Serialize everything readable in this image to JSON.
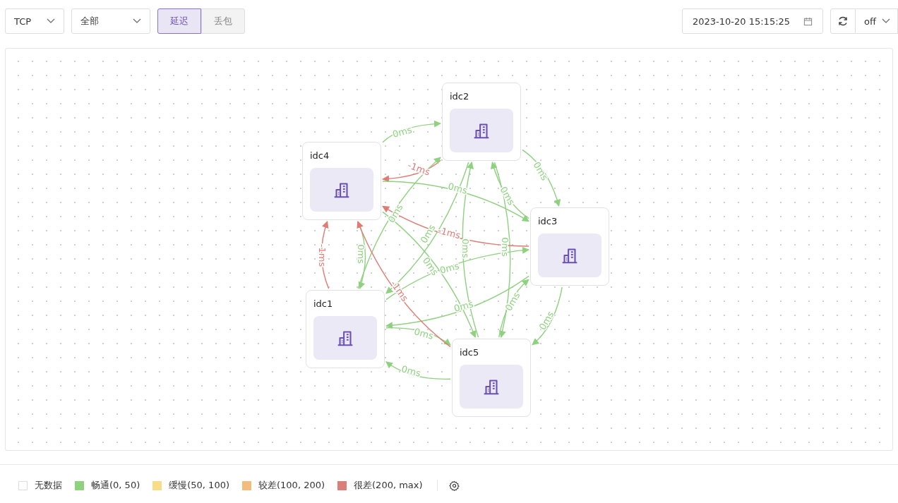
{
  "toolbar": {
    "protocol": "TCP",
    "scope": "全部",
    "tabs": [
      {
        "label": "延迟",
        "selected": true
      },
      {
        "label": "丢包",
        "selected": false
      }
    ],
    "time": "2023-10-20 15:15:25",
    "refresh_interval": "off"
  },
  "topology": {
    "nodes": [
      {
        "name": "idc2",
        "links": [
          {
            "label": "-1ms",
            "color": "#e07b73"
          },
          {
            "label": "0ms",
            "color": "#8ed17f"
          },
          {
            "label": "0ms",
            "color": "#8ed17f"
          },
          {
            "label": "0ms",
            "color": "#8ed17f"
          }
        ]
      },
      {
        "name": "idc4",
        "links": [
          {
            "label": "0ms",
            "color": "#8ed17f"
          },
          {
            "label": "0ms",
            "color": "#8ed17f"
          },
          {
            "label": "0ms",
            "color": "#8ed17f"
          },
          {
            "label": "0ms",
            "color": "#8ed17f"
          }
        ]
      },
      {
        "name": "idc3",
        "links": [
          {
            "label": "-1ms",
            "color": "#e07b73"
          },
          {
            "label": "0ms",
            "color": "#8ed17f"
          },
          {
            "label": "0ms",
            "color": "#8ed17f"
          },
          {
            "label": "0ms",
            "color": "#8ed17f"
          }
        ]
      },
      {
        "name": "idc1",
        "links": [
          {
            "label": "-1ms",
            "color": "#e07b73"
          },
          {
            "label": "0ms",
            "color": "#8ed17f"
          },
          {
            "label": "0ms",
            "color": "#8ed17f"
          },
          {
            "label": "0ms",
            "color": "#8ed17f"
          }
        ]
      },
      {
        "name": "idc5",
        "links": [
          {
            "label": "-1ms",
            "color": "#e07b73"
          },
          {
            "label": "0ms",
            "color": "#8ed17f"
          },
          {
            "label": "0ms",
            "color": "#8ed17f"
          },
          {
            "label": "0ms",
            "color": "#8ed17f"
          }
        ]
      }
    ]
  },
  "legend": [
    {
      "label": "无数据",
      "color": "#ffffff"
    },
    {
      "label": "畅通(0, 50)",
      "color": "#8ed17f"
    },
    {
      "label": "缓慢(50, 100)",
      "color": "#f7dc8a"
    },
    {
      "label": "较差(100, 200)",
      "color": "#f2bc7f"
    },
    {
      "label": "很差(200, max)",
      "color": "#d9807a"
    }
  ]
}
